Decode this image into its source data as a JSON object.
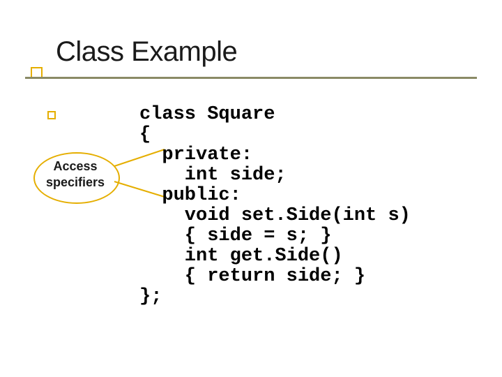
{
  "title": "Class Example",
  "callout": {
    "line1": "Access",
    "line2": "specifiers"
  },
  "code": {
    "l1": "class Square",
    "l2": "{",
    "l3": "  private:",
    "l4": "    int side;",
    "l5": "  public:",
    "l6": "    void set.Side(int s)",
    "l7": "    { side = s; }",
    "l8": "    int get.Side()",
    "l9": "    { return side; }",
    "l10": "};"
  }
}
